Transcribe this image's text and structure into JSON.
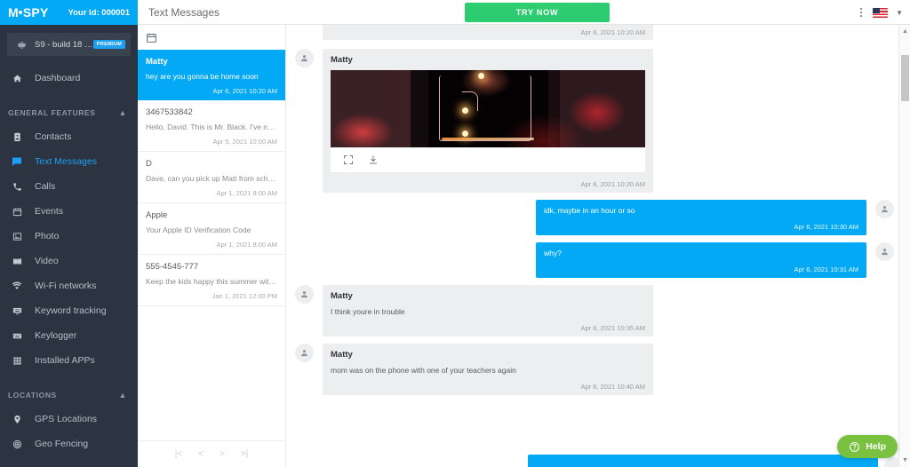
{
  "brand": {
    "logo_text": "SPY",
    "logo_prefix": "M",
    "account_id": "Your Id: 000001"
  },
  "device": {
    "name": "S9 - build 18 -...",
    "badge": "PREMIUM",
    "icon": "android-icon"
  },
  "sidebar": {
    "dashboard": {
      "label": "Dashboard",
      "icon": "home-icon"
    },
    "sections": [
      {
        "label": "GENERAL FEATURES",
        "items": [
          {
            "label": "Contacts",
            "icon": "contacts-icon",
            "active": false
          },
          {
            "label": "Text Messages",
            "icon": "message-icon",
            "active": true
          },
          {
            "label": "Calls",
            "icon": "phone-icon",
            "active": false
          },
          {
            "label": "Events",
            "icon": "calendar-icon",
            "active": false
          },
          {
            "label": "Photo",
            "icon": "photo-icon",
            "active": false
          },
          {
            "label": "Video",
            "icon": "video-icon",
            "active": false
          },
          {
            "label": "Wi-Fi networks",
            "icon": "wifi-icon",
            "active": false
          },
          {
            "label": "Keyword tracking",
            "icon": "keyword-icon",
            "active": false
          },
          {
            "label": "Keylogger",
            "icon": "keyboard-icon",
            "active": false
          },
          {
            "label": "Installed APPs",
            "icon": "grid-icon",
            "active": false
          }
        ]
      },
      {
        "label": "LOCATIONS",
        "items": [
          {
            "label": "GPS Locations",
            "icon": "pin-icon",
            "active": false
          },
          {
            "label": "Geo Fencing",
            "icon": "target-icon",
            "active": false
          }
        ]
      }
    ]
  },
  "topbar": {
    "title": "Text Messages",
    "try_now_label": "TRY NOW",
    "menu_icon": "kebab-menu-icon",
    "locale_flag": "us-flag-icon",
    "locale_chevron": "chevron-down-icon"
  },
  "conversations": {
    "date_filter_icon": "calendar-icon",
    "items": [
      {
        "name": "Matty",
        "preview": "hey are you gonna be home soon",
        "time": "Apr 6, 2021 10:20 AM",
        "active": true
      },
      {
        "name": "3467533842",
        "preview": "Hello, David. This is Mr. Black. I've noti...",
        "time": "Apr 5, 2021 10:00 AM",
        "active": false
      },
      {
        "name": "D",
        "preview": "Dave, can you pick up Matt from schoo...",
        "time": "Apr 1, 2021 8:00 AM",
        "active": false
      },
      {
        "name": "Apple",
        "preview": "Your Apple ID Verification Code",
        "time": "Apr 1, 2021 8:00 AM",
        "active": false
      },
      {
        "name": "555-4545-777",
        "preview": "Keep the kids happy this summer with ...",
        "time": "Jan 1, 2021 12:00 PM",
        "active": false
      }
    ],
    "pager": {
      "first": "|<",
      "prev": "<",
      "next": ">",
      "last": ">|"
    }
  },
  "thread": {
    "top_partial_time": "Apr 6, 2021 10:20 AM",
    "messages": [
      {
        "direction": "in",
        "sender": "Matty",
        "type": "photo",
        "time": "Apr 6, 2021 10:20 AM",
        "expand_icon": "fullscreen-icon",
        "download_icon": "download-icon"
      },
      {
        "direction": "out",
        "text": "idk, maybe in an hour or so",
        "time": "Apr 6, 2021 10:30 AM",
        "type": "text"
      },
      {
        "direction": "out",
        "text": "why?",
        "time": "Apr 6, 2021 10:31 AM",
        "type": "text"
      },
      {
        "direction": "in",
        "sender": "Matty",
        "text": "I think youre in trouble",
        "time": "Apr 6, 2021 10:35 AM",
        "type": "text"
      },
      {
        "direction": "in",
        "sender": "Matty",
        "text": "mom was on the phone with one of your teachers again",
        "time": "Apr 6, 2021 10:40 AM",
        "type": "text"
      }
    ]
  },
  "help": {
    "label": "Help",
    "icon": "question-circle-icon"
  },
  "colors": {
    "brand_blue": "#03a9f4",
    "sidebar_bg": "#2b3440",
    "try_now_green": "#2ecc71",
    "help_green": "#7ac142",
    "bubble_gray": "#eceef0"
  }
}
